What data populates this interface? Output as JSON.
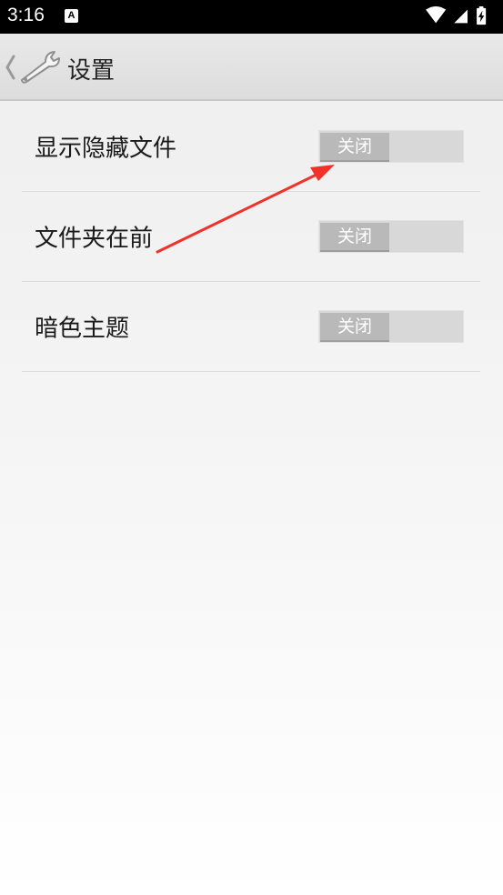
{
  "status_bar": {
    "time": "3:16",
    "notification_icon": "A",
    "icons": [
      "wifi-icon",
      "signal-icon",
      "battery-charging-icon"
    ]
  },
  "action_bar": {
    "title": "设置",
    "icons": [
      "back-chevron-icon",
      "wrench-icon"
    ]
  },
  "settings": [
    {
      "label": "显示隐藏文件",
      "toggle_label": "关闭",
      "on": false
    },
    {
      "label": "文件夹在前",
      "toggle_label": "关闭",
      "on": false
    },
    {
      "label": "暗色主题",
      "toggle_label": "关闭",
      "on": false
    }
  ],
  "colors": {
    "annotation_arrow": "#f0322a",
    "toggle_track": "#d8d8d8",
    "toggle_thumb": "#b9b9b9"
  }
}
